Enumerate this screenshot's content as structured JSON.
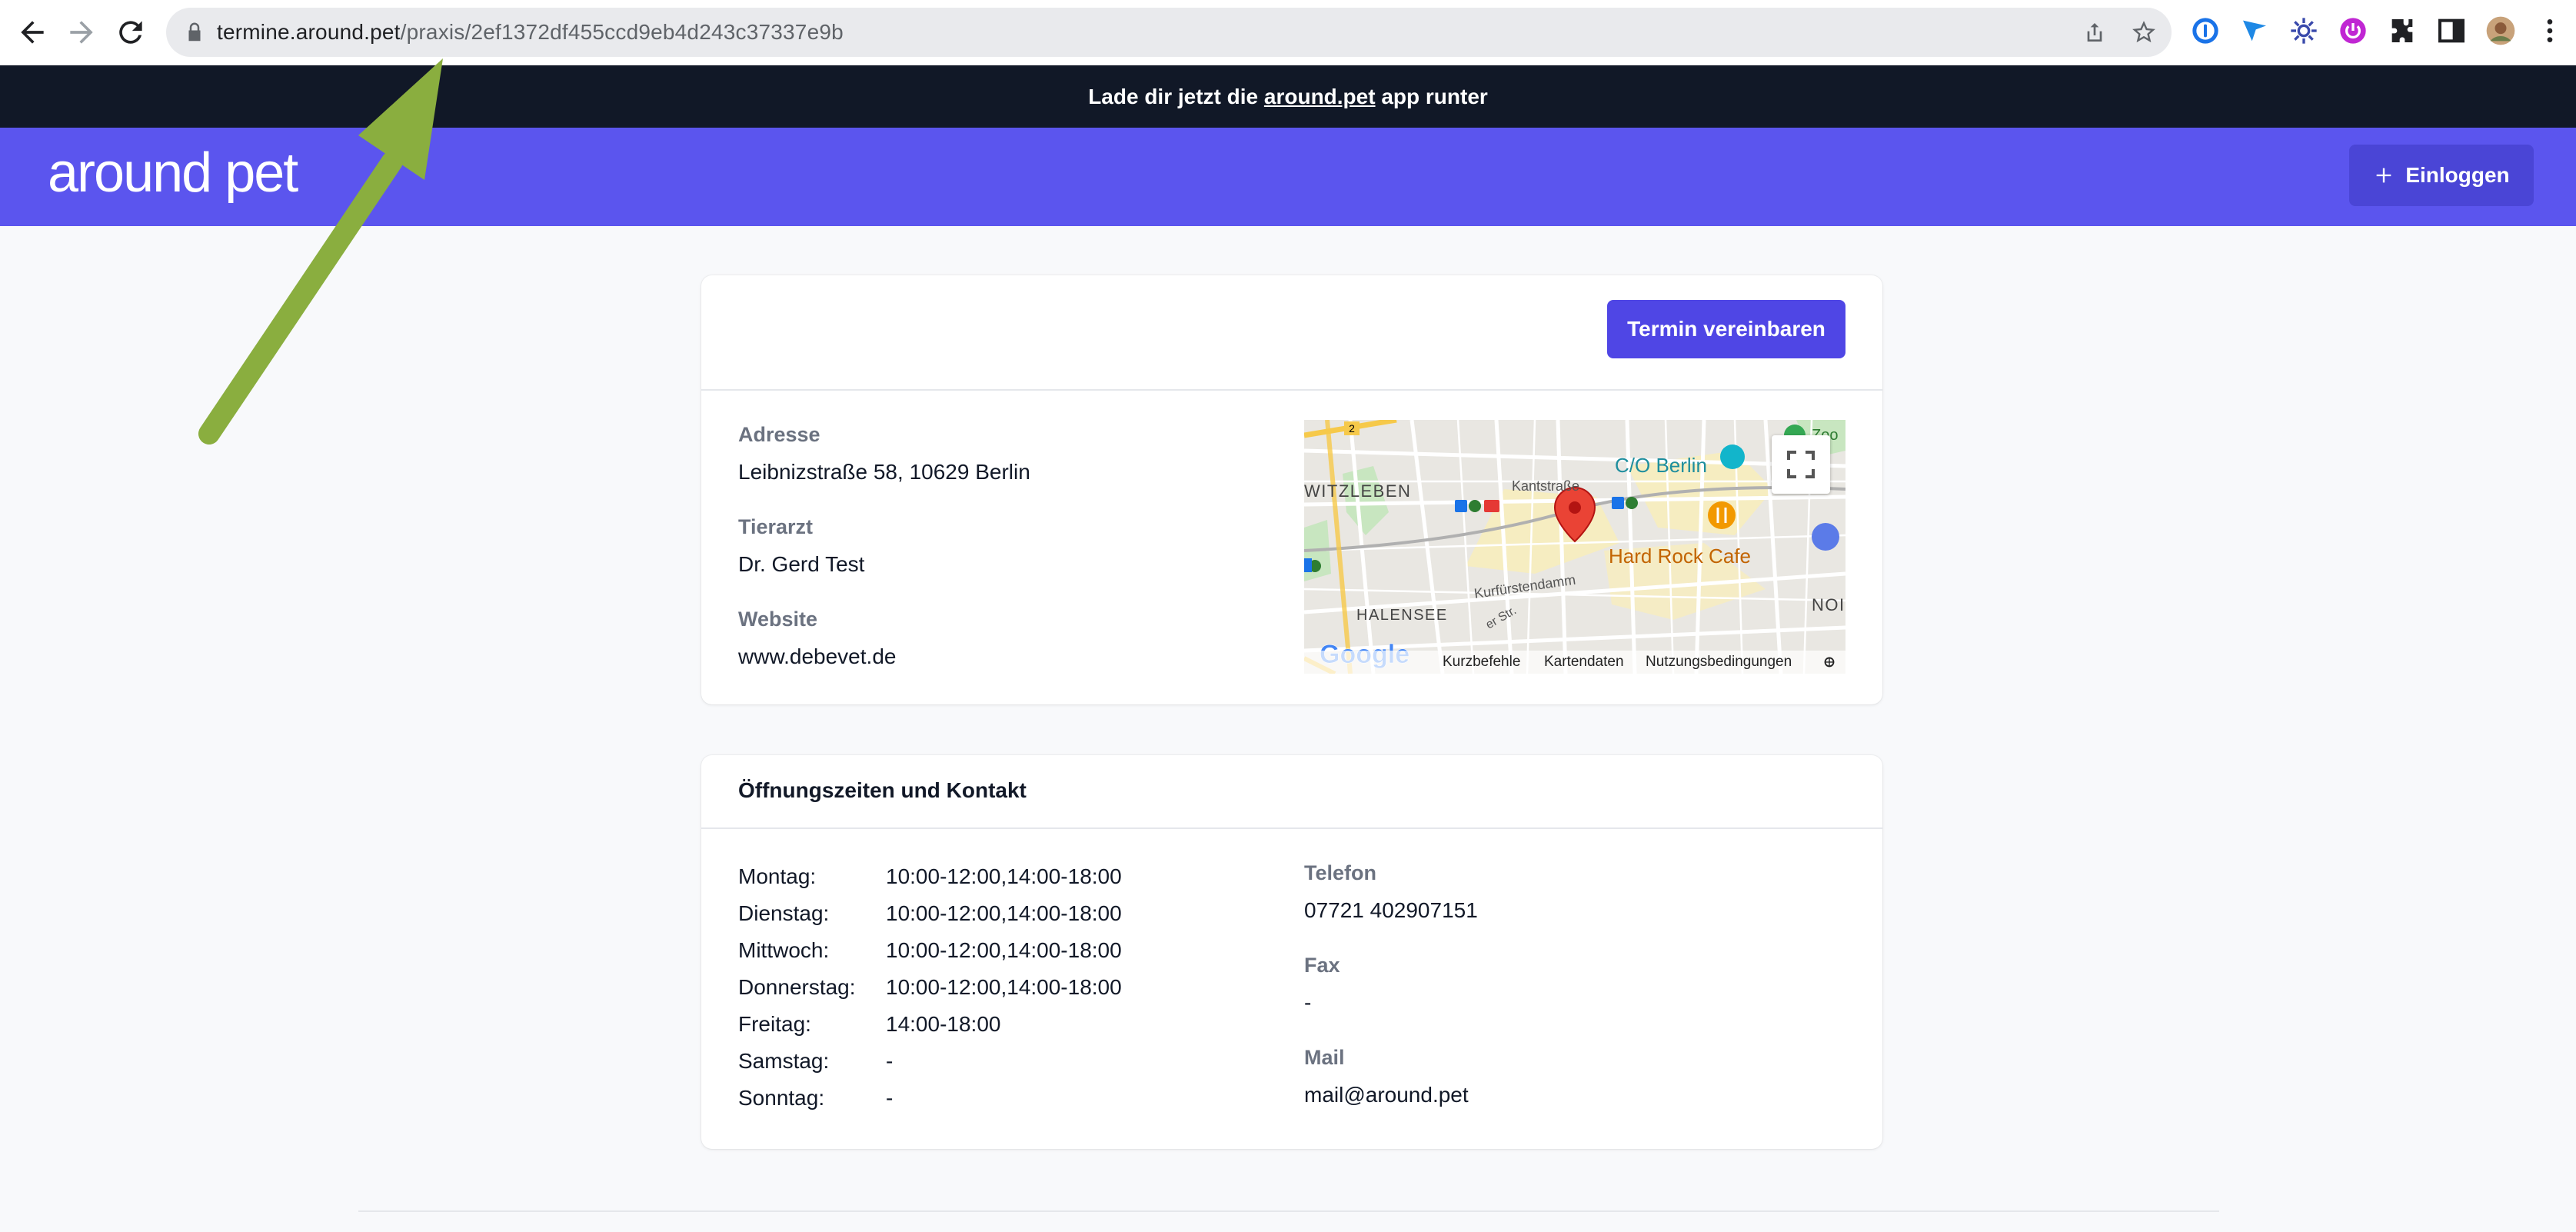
{
  "browser": {
    "url_host": "termine.around.pet",
    "url_path": "/praxis/2ef1372df455ccd9eb4d243c37337e9b",
    "icons": [
      "back-arrow-icon",
      "forward-arrow-icon",
      "reload-icon",
      "lock-icon",
      "share-icon",
      "star-icon",
      "extension-1password-icon",
      "extension-arrow-icon",
      "extension-gear-icon",
      "extension-power-icon",
      "puzzle-icon",
      "sidepanel-icon",
      "profile-avatar",
      "kebab-menu-icon"
    ]
  },
  "promo": {
    "prefix": "Lade dir jetzt die ",
    "link": "around.pet",
    "suffix": " app runter"
  },
  "header": {
    "logo": "around pet",
    "login_label": "Einloggen"
  },
  "practice": {
    "cta_label": "Termin vereinbaren",
    "address_label": "Adresse",
    "address_value": "Leibnizstraße 58, 10629 Berlin",
    "vet_label": "Tierarzt",
    "vet_value": "Dr. Gerd Test",
    "website_label": "Website",
    "website_value": "www.debevet.de"
  },
  "map": {
    "labels": {
      "witzleben": "WITZLEBEN",
      "co_berlin": "C/O Berlin",
      "hard_rock": "Hard Rock Cafe",
      "halensee": "HALENSEE",
      "kurfuerstendamm": "Kurfürstendamm",
      "kantstrasse": "Kantstraße",
      "noi": "NOI",
      "zoo": "Zoo",
      "road_number": "2",
      "str": "er Str."
    },
    "google": "Google",
    "footer": {
      "shortcuts": "Kurzbefehle",
      "data": "Kartendaten",
      "terms": "Nutzungsbedingungen"
    }
  },
  "contact": {
    "title": "Öffnungszeiten und Kontakt",
    "hours": [
      {
        "day": "Montag:",
        "time": "10:00-12:00,14:00-18:00"
      },
      {
        "day": "Dienstag:",
        "time": "10:00-12:00,14:00-18:00"
      },
      {
        "day": "Mittwoch:",
        "time": "10:00-12:00,14:00-18:00"
      },
      {
        "day": "Donnerstag:",
        "time": "10:00-12:00,14:00-18:00"
      },
      {
        "day": "Freitag:",
        "time": "14:00-18:00"
      },
      {
        "day": "Samstag:",
        "time": "-"
      },
      {
        "day": "Sonntag:",
        "time": "-"
      }
    ],
    "phone_label": "Telefon",
    "phone_value": "07721 402907151",
    "fax_label": "Fax",
    "fax_value": "-",
    "mail_label": "Mail",
    "mail_value": "mail@around.pet"
  },
  "colors": {
    "brand": "#5b55ee",
    "button": "#4f46e5",
    "banner": "#111827",
    "annotation_arrow": "#8aae3f"
  }
}
